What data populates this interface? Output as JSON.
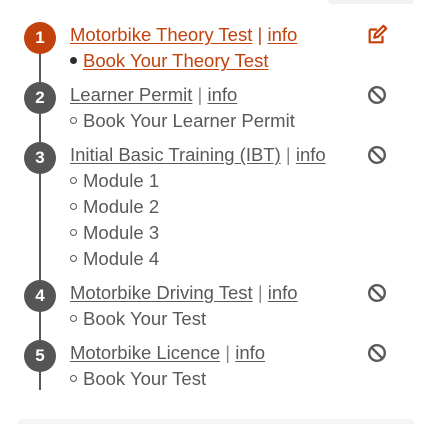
{
  "steps": [
    {
      "number": "1",
      "title": "Motorbike Theory Test",
      "separator": "|",
      "info": "info",
      "status_icon": "edit-icon",
      "state": "active",
      "items": [
        "Book Your Theory Test"
      ]
    },
    {
      "number": "2",
      "title": "Learner Permit",
      "separator": "|",
      "info": "info",
      "status_icon": "blocked-icon",
      "state": "inactive",
      "items": [
        "Book Your Learner Permit"
      ]
    },
    {
      "number": "3",
      "title": "Initial Basic Training (IBT)",
      "separator": "|",
      "info": "info",
      "status_icon": "blocked-icon",
      "state": "inactive",
      "items": [
        "Module 1",
        "Module 2",
        "Module 3",
        "Module 4"
      ]
    },
    {
      "number": "4",
      "title": "Motorbike Driving Test",
      "separator": "|",
      "info": "info",
      "status_icon": "blocked-icon",
      "state": "inactive",
      "items": [
        "Book Your Test"
      ]
    },
    {
      "number": "5",
      "title": "Motorbike Licence",
      "separator": "|",
      "info": "info",
      "status_icon": "blocked-icon",
      "state": "inactive",
      "items": [
        "Book Your Test"
      ]
    }
  ],
  "colors": {
    "active": "#c2410c",
    "inactive": "#595959"
  }
}
